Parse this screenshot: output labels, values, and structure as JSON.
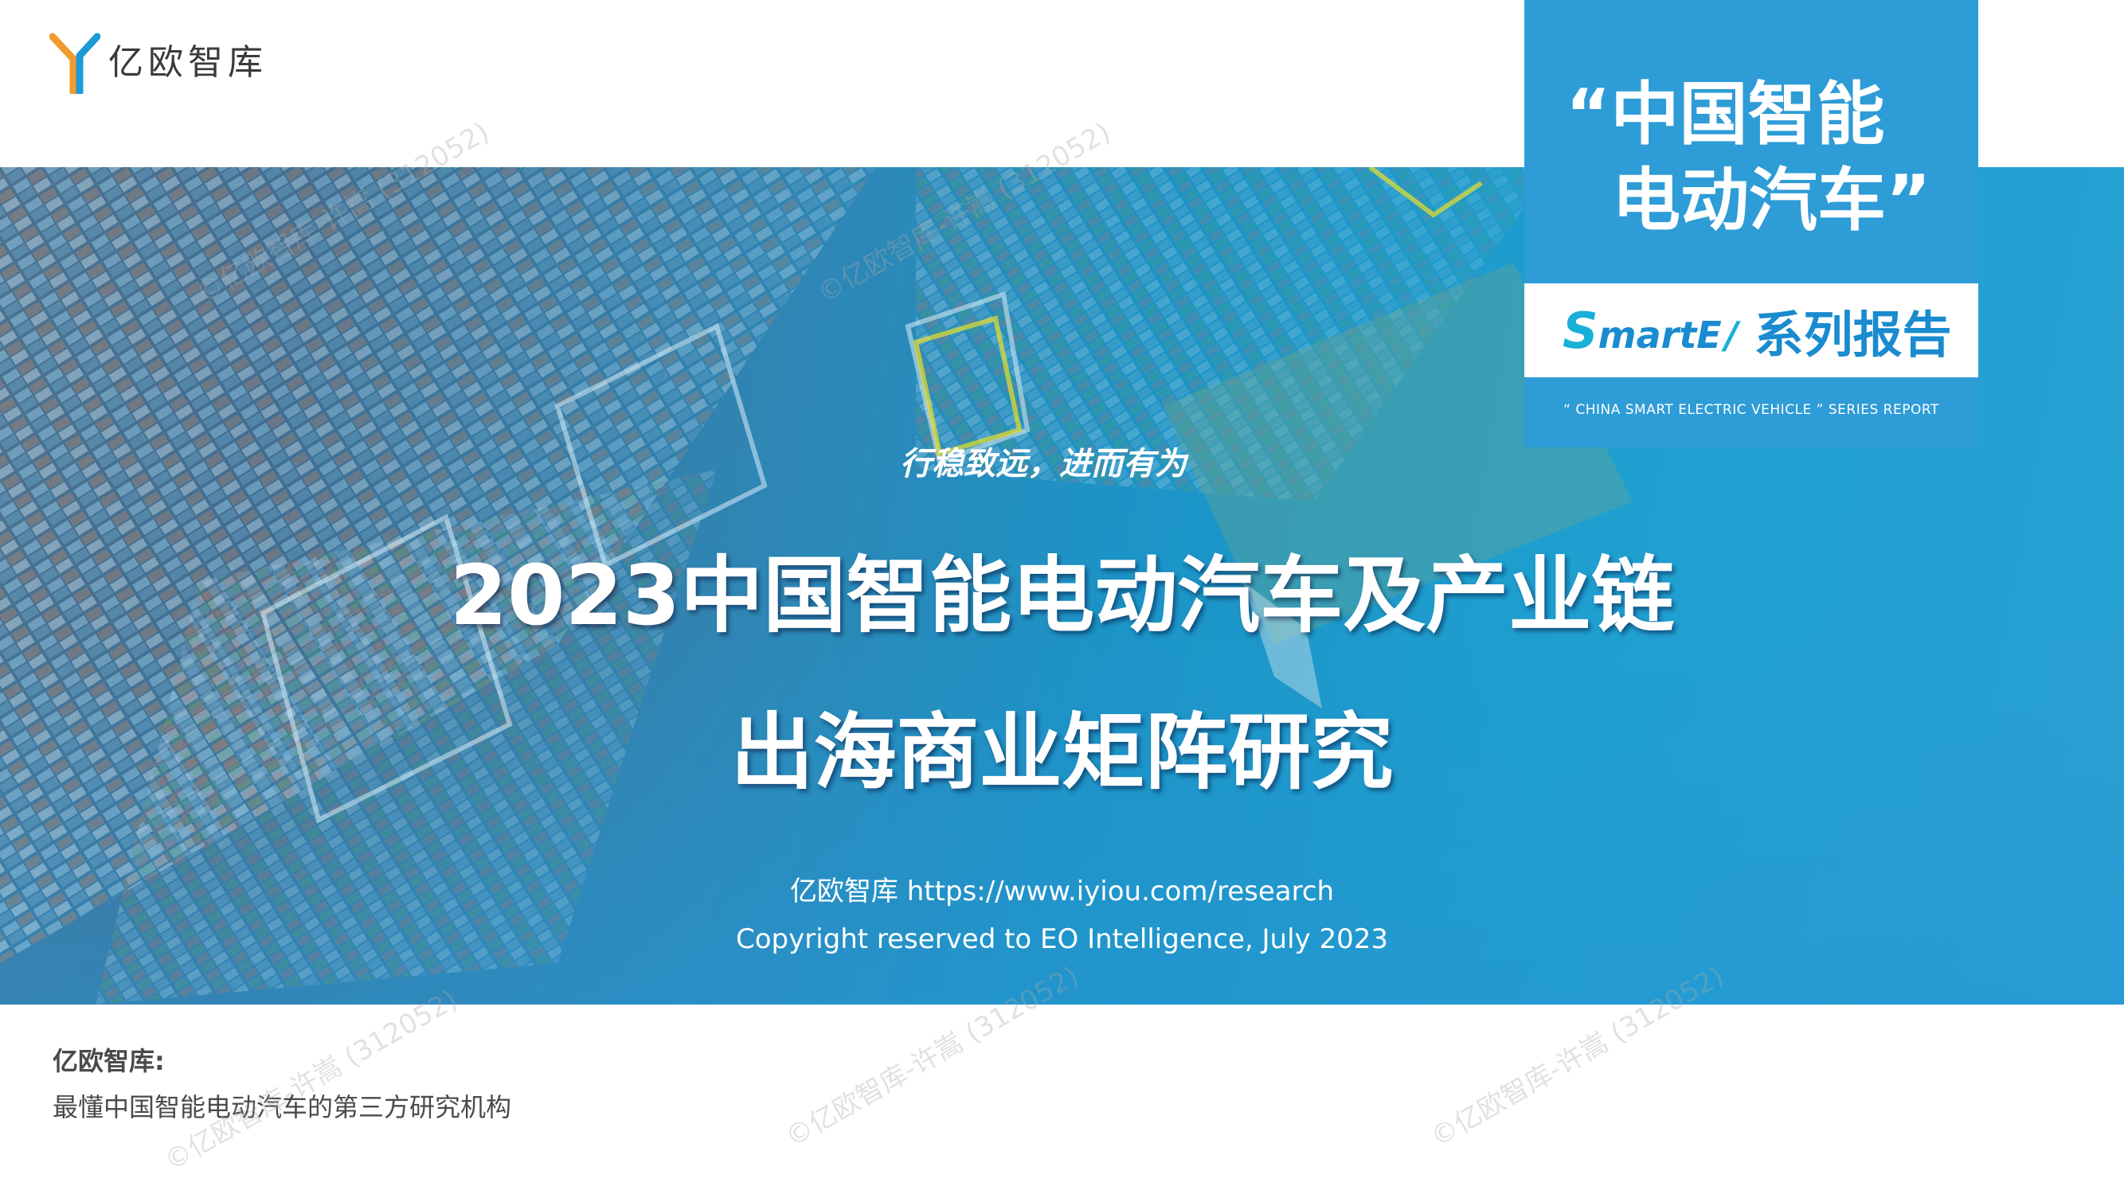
{
  "brand": {
    "name": "亿欧智库",
    "logo_colors": [
      "#f29a2e",
      "#1c9ad6"
    ]
  },
  "series_box": {
    "title_line1": "“中国智能",
    "title_line2": "电动汽车”",
    "smart_logo_s": "S",
    "smart_logo_rest": "martE",
    "smart_logo_slash": "/",
    "series_label": "系列报告",
    "english": "“ CHINA SMART ELECTRIC VEHICLE ”   SERIES REPORT",
    "background_color": "#2e9cd6"
  },
  "cover": {
    "tagline": "行稳致远，进而有为",
    "title_line1": "2023中国智能电动汽车及产业链",
    "title_line2": "出海商业矩阵研究",
    "url_line": "亿欧智库 https://www.iyiou.com/research",
    "copyright": "Copyright reserved to EO Intelligence, July 2023"
  },
  "footer": {
    "org_name": "亿欧智库:",
    "description": "最懂中国智能电动汽车的第三方研究机构"
  },
  "watermark": {
    "text": "©亿欧智库-许嵩 (312052)"
  }
}
